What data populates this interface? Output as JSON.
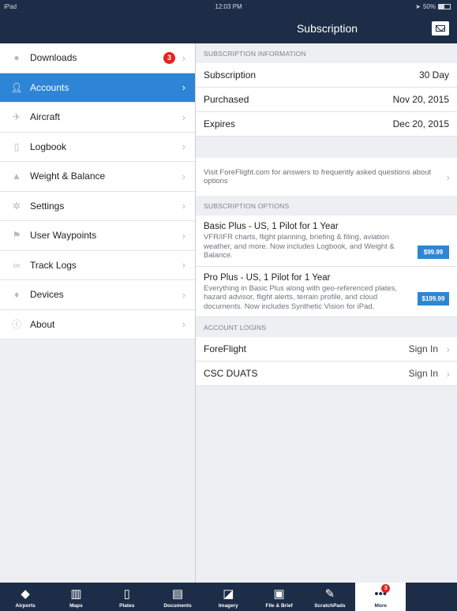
{
  "status_bar": {
    "device": "iPad",
    "time": "12:03 PM",
    "battery": "50%"
  },
  "header": {
    "title": "Subscription",
    "mail_icon": "mail-icon"
  },
  "sidebar": {
    "items": [
      {
        "label": "Downloads",
        "icon": "download-icon",
        "badge": "3"
      },
      {
        "label": "Accounts",
        "icon": "person-icon",
        "active": true
      },
      {
        "label": "Aircraft",
        "icon": "airplane-icon"
      },
      {
        "label": "Logbook",
        "icon": "book-icon"
      },
      {
        "label": "Weight & Balance",
        "icon": "scale-icon"
      },
      {
        "label": "Settings",
        "icon": "gear-icon"
      },
      {
        "label": "User Waypoints",
        "icon": "flag-icon"
      },
      {
        "label": "Track Logs",
        "icon": "track-icon"
      },
      {
        "label": "Devices",
        "icon": "plug-icon"
      },
      {
        "label": "About",
        "icon": "info-icon"
      }
    ]
  },
  "main": {
    "subscription_info": {
      "header": "SUBSCRIPTION INFORMATION",
      "rows": [
        {
          "label": "Subscription",
          "value": "30 Day"
        },
        {
          "label": "Purchased",
          "value": "Nov 20, 2015"
        },
        {
          "label": "Expires",
          "value": "Dec 20, 2015"
        }
      ]
    },
    "info_text": "Visit ForeFlight.com for answers to frequently asked questions about options",
    "subscription_options": {
      "header": "SUBSCRIPTION OPTIONS",
      "plans": [
        {
          "title": "Basic Plus - US, 1 Pilot for 1 Year",
          "description": "VFR/IFR charts, flight planning, briefing & filing, aviation weather, and more. Now includes Logbook, and Weight & Balance.",
          "price": "$99.99"
        },
        {
          "title": "Pro Plus - US, 1 Pilot for 1 Year",
          "description": "Everything in Basic Plus along with geo-referenced plates, hazard advisor, flight alerts, terrain profile, and cloud documents. Now includes Synthetic Vision for iPad.",
          "price": "$199.99"
        }
      ]
    },
    "account_logins": {
      "header": "ACCOUNT LOGINS",
      "rows": [
        {
          "label": "ForeFlight",
          "action": "Sign In"
        },
        {
          "label": "CSC DUATS",
          "action": "Sign In"
        }
      ]
    }
  },
  "tabbar": {
    "tabs": [
      {
        "label": "Airports",
        "icon": "airport-icon"
      },
      {
        "label": "Maps",
        "icon": "map-icon"
      },
      {
        "label": "Plates",
        "icon": "plates-icon"
      },
      {
        "label": "Documents",
        "icon": "documents-icon"
      },
      {
        "label": "Imagery",
        "icon": "imagery-icon"
      },
      {
        "label": "File & Brief",
        "icon": "file-brief-icon"
      },
      {
        "label": "ScratchPads",
        "icon": "scratchpad-icon"
      },
      {
        "label": "More",
        "icon": "more-icon",
        "badge": "3",
        "active": true
      }
    ]
  },
  "colors": {
    "nav": "#1d2d47",
    "accent": "#2e85d6",
    "badge": "#e3231f"
  }
}
